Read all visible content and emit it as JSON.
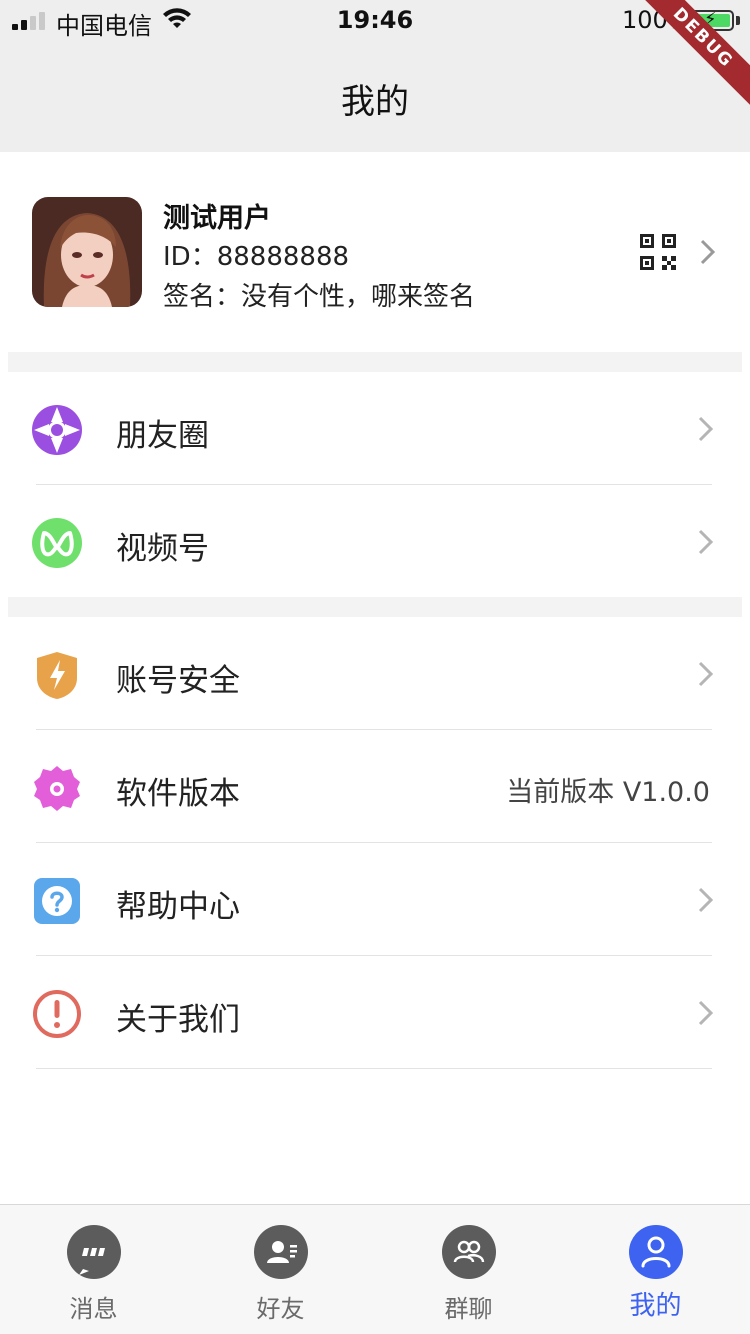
{
  "status_bar": {
    "carrier": "中国电信",
    "time": "19:46",
    "battery": "100%",
    "debug": "DEBUG"
  },
  "header": {
    "title": "我的"
  },
  "profile": {
    "name": "测试用户",
    "id": "ID：88888888",
    "signature": "签名：没有个性，哪来签名",
    "qr_icon": "qrcode-icon"
  },
  "menu_group_1": [
    {
      "label": "朋友圈",
      "icon": "moments-icon",
      "color": "#9b4fe0"
    },
    {
      "label": "视频号",
      "icon": "channels-icon",
      "color": "#6fe06c"
    }
  ],
  "menu_group_2": [
    {
      "label": "账号安全",
      "icon": "shield-icon",
      "color": "#e8a24a"
    },
    {
      "label": "软件版本",
      "icon": "gear-icon",
      "color": "#e25fd9",
      "value": "当前版本 V1.0.0"
    },
    {
      "label": "帮助中心",
      "icon": "help-icon",
      "color": "#5aa7ec"
    },
    {
      "label": "关于我们",
      "icon": "warning-icon",
      "color": "#e06a5e"
    }
  ],
  "tabbar": {
    "items": [
      {
        "label": "消息",
        "icon": "chat-icon"
      },
      {
        "label": "好友",
        "icon": "contacts-icon"
      },
      {
        "label": "群聊",
        "icon": "group-icon"
      },
      {
        "label": "我的",
        "icon": "user-icon"
      }
    ],
    "active_index": 3,
    "active_color": "#3d63f0"
  }
}
